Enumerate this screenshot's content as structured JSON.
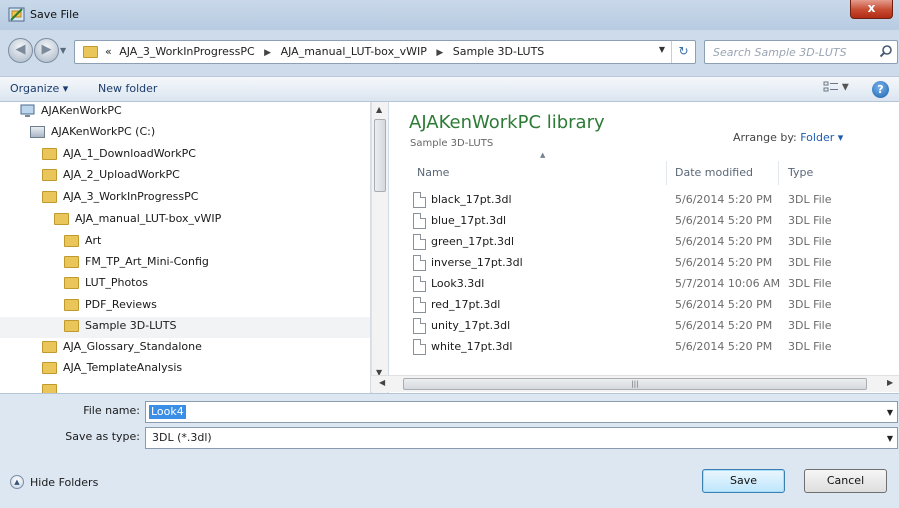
{
  "window": {
    "title": "Save File",
    "close_label": "x"
  },
  "address": {
    "crumbs": [
      "AJA_3_WorkInProgressPC",
      "AJA_manual_LUT-box_vWIP",
      "Sample 3D-LUTS"
    ],
    "overflow_label": "«",
    "search_placeholder": "Search Sample 3D-LUTS"
  },
  "toolbar": {
    "organize_label": "Organize ▾",
    "new_folder_label": "New folder",
    "help_label": "?"
  },
  "nav_tree": [
    {
      "label": "AJAKenWorkPC",
      "icon": "computer-icon"
    },
    {
      "label": "AJAKenWorkPC (C:)",
      "icon": "drive-icon"
    },
    {
      "label": "AJA_1_DownloadWorkPC",
      "icon": "folder-icon"
    },
    {
      "label": "AJA_2_UploadWorkPC",
      "icon": "folder-icon"
    },
    {
      "label": "AJA_3_WorkInProgressPC",
      "icon": "folder-icon"
    },
    {
      "label": "AJA_manual_LUT-box_vWIP",
      "icon": "folder-icon"
    },
    {
      "label": "Art",
      "icon": "folder-icon"
    },
    {
      "label": "FM_TP_Art_Mini-Config",
      "icon": "folder-icon"
    },
    {
      "label": "LUT_Photos",
      "icon": "folder-icon"
    },
    {
      "label": "PDF_Reviews",
      "icon": "folder-icon"
    },
    {
      "label": "Sample 3D-LUTS",
      "icon": "folder-icon",
      "selected": true
    },
    {
      "label": "AJA_Glossary_Standalone",
      "icon": "folder-icon"
    },
    {
      "label": "AJA_TemplateAnalysis",
      "icon": "folder-icon"
    }
  ],
  "library": {
    "title": "AJAKenWorkPC library",
    "subtitle": "Sample 3D-LUTS",
    "arrange_label": "Arrange by:",
    "arrange_value": "Folder ▾"
  },
  "columns": {
    "name": "Name",
    "date": "Date modified",
    "type": "Type"
  },
  "files": [
    {
      "name": "black_17pt.3dl",
      "date": "5/6/2014 5:20 PM",
      "type": "3DL File"
    },
    {
      "name": "blue_17pt.3dl",
      "date": "5/6/2014 5:20 PM",
      "type": "3DL File"
    },
    {
      "name": "green_17pt.3dl",
      "date": "5/6/2014 5:20 PM",
      "type": "3DL File"
    },
    {
      "name": "inverse_17pt.3dl",
      "date": "5/6/2014 5:20 PM",
      "type": "3DL File"
    },
    {
      "name": "Look3.3dl",
      "date": "5/7/2014 10:06 AM",
      "type": "3DL File"
    },
    {
      "name": "red_17pt.3dl",
      "date": "5/6/2014 5:20 PM",
      "type": "3DL File"
    },
    {
      "name": "unity_17pt.3dl",
      "date": "5/6/2014 5:20 PM",
      "type": "3DL File"
    },
    {
      "name": "white_17pt.3dl",
      "date": "5/6/2014 5:20 PM",
      "type": "3DL File"
    }
  ],
  "form": {
    "file_name_label": "File name:",
    "file_name_value": "Look4",
    "save_type_label": "Save as type:",
    "save_type_value": "3DL (*.3dl)",
    "hide_folders_label": "Hide Folders",
    "save_label": "Save",
    "cancel_label": "Cancel"
  },
  "colors": {
    "library_title": "#2d7b36",
    "selection": "#3a8ee6",
    "close_button": "#c74a31"
  }
}
